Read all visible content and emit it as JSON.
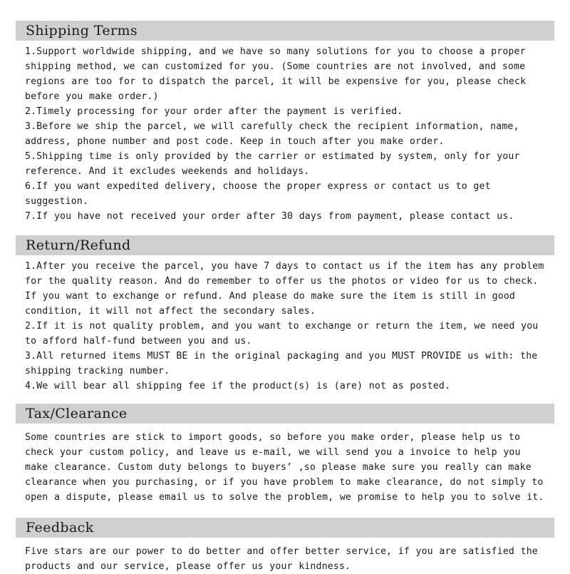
{
  "document": {
    "background_color": "#ffffff",
    "heading_bar_color": "#cfcfcf",
    "text_color": "#1a1a1a"
  },
  "sections": [
    {
      "heading": "Shipping Terms",
      "paragraphs": [
        "1.Support worldwide shipping, and we have so many solutions for you to choose a proper shipping method, we can customized for you. (Some countries are not involved, and some regions are too for to dispatch the parcel, it will be expensive for you, please check before you make order.)",
        "2.Timely processing for your order after the payment is verified.",
        "3.Before we ship the parcel, we will carefully check the recipient information, name, address, phone number and post code. Keep in touch after you make order.",
        "5.Shipping time is only provided by the carrier or estimated by system, only for your reference. And it excludes weekends and holidays.",
        "6.If you want expedited delivery, choose the proper express or contact us to get suggestion.",
        "7.If you have not received your order after 30 days from payment, please contact us."
      ]
    },
    {
      "heading": "Return/Refund",
      "paragraphs": [
        "1.After you receive the parcel, you have 7 days to contact us if the item has any problem for the quality reason. And do remember to offer us the photos or video for us to check. If you want to exchange or refund. And please do make sure the item is still in good condition, it will not affect the secondary sales.",
        "2.If it is not quality problem, and you want to exchange or return the item, we need you to afford half-fund between you and us.",
        "3.All returned items MUST BE in the original packaging and you MUST PROVIDE us with: the shipping tracking number.",
        "4.We will bear all shipping fee if the product(s) is (are) not as posted."
      ]
    },
    {
      "heading": "Tax/Clearance",
      "paragraphs": [
        "Some countries are stick to import goods, so before you make order, please help us to check your custom policy, and leave us e-mail, we will send you a invoice to help you make clearance. Custom duty belongs to buyers’ ,so please make sure you really can make clearance when you purchasing, or if you have problem to make clearance, do not simply to open a dispute, please email us to solve the problem, we promise to help you to solve it."
      ]
    },
    {
      "heading": "Feedback",
      "paragraphs": [
        "Five stars are our power to do better and offer better service, if you are satisfied the products and our service, please offer us your kindness."
      ]
    }
  ]
}
